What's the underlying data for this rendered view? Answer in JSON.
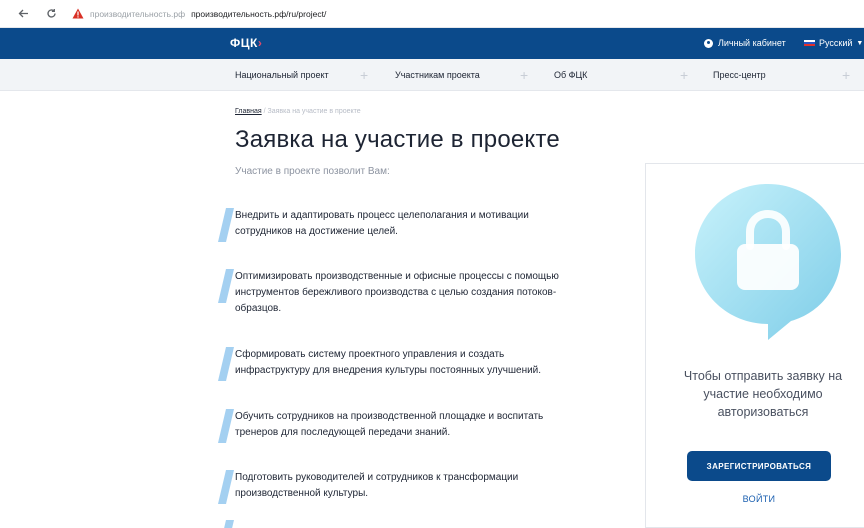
{
  "browser": {
    "back_icon": "arrow-left-icon",
    "reload_icon": "reload-icon",
    "warning_icon": "warning-triangle-icon",
    "domain_faded": "производительность.рф",
    "url": "производительность.рф/ru/project/"
  },
  "header": {
    "logo_text": "ФЦК",
    "logo_mark": "›",
    "cabinet_label": "Личный кабинет",
    "language_label": "Русский",
    "bg_color": "#0b4a8b"
  },
  "nav": {
    "items": [
      {
        "label": "Национальный проект"
      },
      {
        "label": "Участникам проекта"
      },
      {
        "label": "Об ФЦК"
      },
      {
        "label": "Пресс-центр"
      }
    ],
    "plus_symbol": "+"
  },
  "breadcrumb": {
    "home": "Главная",
    "separator": "/",
    "current": "Заявка на участие в проекте"
  },
  "page": {
    "title": "Заявка на участие в проекте",
    "subtitle": "Участие в проекте позволит Вам:",
    "benefits": [
      "Внедрить и адаптировать процесс целеполагания и мотивации\nсотрудников на достижение целей.",
      "Оптимизировать производственные и офисные процессы с помощью\nинструментов бережливого производства с целью создания потоков-\nобразцов.",
      "Сформировать систему проектного управления и создать\nинфраструктуру для внедрения культуры постоянных улучшений.",
      "Обучить сотрудников на производственной площадке и воспитать\nтренеров для последующей передачи знаний.",
      "Подготовить руководителей и сотрудников к трансформации\nпроизводственной культуры."
    ]
  },
  "auth": {
    "lock_icon": "lock-icon",
    "message": "Чтобы отправить заявку на участие необходимо авторизоваться",
    "register_label": "ЗАРЕГИСТРИРОВАТЬСЯ",
    "login_label": "ВОЙТИ",
    "accent_color": "#0b4a8b"
  }
}
